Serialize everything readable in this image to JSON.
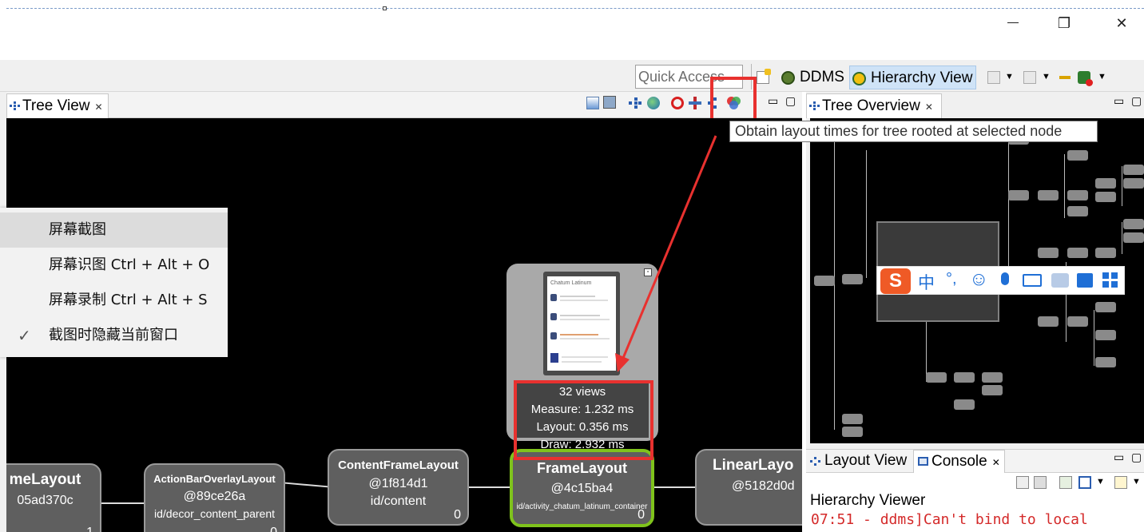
{
  "titlebar": {
    "restore_glyph": "❐",
    "close_glyph": "✕"
  },
  "toolbar": {
    "quick_access_placeholder": "Quick Access",
    "perspectives": [
      "DDMS",
      "Hierarchy View"
    ]
  },
  "tree_view": {
    "tab_label": "Tree View",
    "close_glyph": "✕",
    "nodes": [
      {
        "name": "meLayout",
        "hash": "05ad370c",
        "id": "",
        "count": "1"
      },
      {
        "name": "ActionBarOverlayLayout",
        "hash": "@89ce26a",
        "id": "id/decor_content_parent",
        "count": "0"
      },
      {
        "name": "ContentFrameLayout",
        "hash": "@1f814d1",
        "id": "id/content",
        "count": "0"
      },
      {
        "name": "FrameLayout",
        "hash": "@4c15ba4",
        "id": "id/activity_chatum_latinum_container",
        "count": "0"
      },
      {
        "name": "LinearLayo",
        "hash": "@5182d0d",
        "id": "",
        "count": ""
      }
    ],
    "preview": {
      "app_title": "Chatum Latinum",
      "views": "32 views",
      "measure": "Measure: 1.232 ms",
      "layout": "Layout: 0.356 ms",
      "draw": "Draw: 2.932 ms"
    }
  },
  "tooltip": "Obtain layout times for tree rooted at selected node",
  "context_menu": {
    "items": [
      {
        "label": "屏幕截图",
        "checked": false
      },
      {
        "label": "屏幕识图 Ctrl + Alt + O",
        "checked": false
      },
      {
        "label": "屏幕录制 Ctrl + Alt + S",
        "checked": false
      },
      {
        "label": "截图时隐藏当前窗口",
        "checked": true
      }
    ],
    "check_glyph": "✓"
  },
  "tree_overview": {
    "tab_label": "Tree Overview",
    "close_glyph": "✕"
  },
  "ime_bar": {
    "logo": "S",
    "mode": "中",
    "punct": "°,",
    "emoji_glyph": "☺"
  },
  "bottom": {
    "tabs": [
      "Layout View",
      "Console"
    ],
    "close_glyph": "✕",
    "console_title": "Hierarchy Viewer",
    "console_line": "07:51 - ddms]Can't bind to local"
  },
  "colors": {
    "highlight_red": "#e8312f",
    "selected_green": "#7fc31c",
    "canvas_bg": "#000000"
  }
}
